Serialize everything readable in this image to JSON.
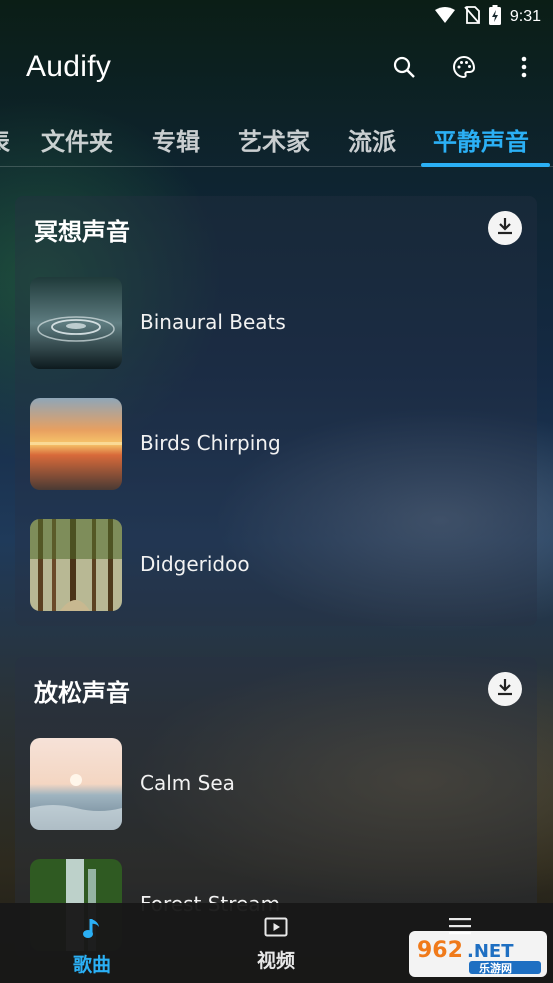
{
  "status": {
    "time": "9:31"
  },
  "app": {
    "title": "Audify"
  },
  "tabs": [
    {
      "label": "表"
    },
    {
      "label": "文件夹"
    },
    {
      "label": "专辑"
    },
    {
      "label": "艺术家"
    },
    {
      "label": "流派"
    },
    {
      "label": "平静声音"
    }
  ],
  "sections": [
    {
      "title": "冥想声音",
      "tracks": [
        {
          "name": "Binaural Beats"
        },
        {
          "name": "Birds Chirping"
        },
        {
          "name": "Didgeridoo"
        }
      ]
    },
    {
      "title": "放松声音",
      "tracks": [
        {
          "name": "Calm Sea"
        },
        {
          "name": "Forest Stream"
        }
      ]
    }
  ],
  "bottom_nav": [
    {
      "label": "歌曲"
    },
    {
      "label": "视频"
    }
  ],
  "watermark": {
    "text": "962.NET",
    "sub": "乐游网"
  },
  "colors": {
    "accent": "#2bb0f5"
  }
}
